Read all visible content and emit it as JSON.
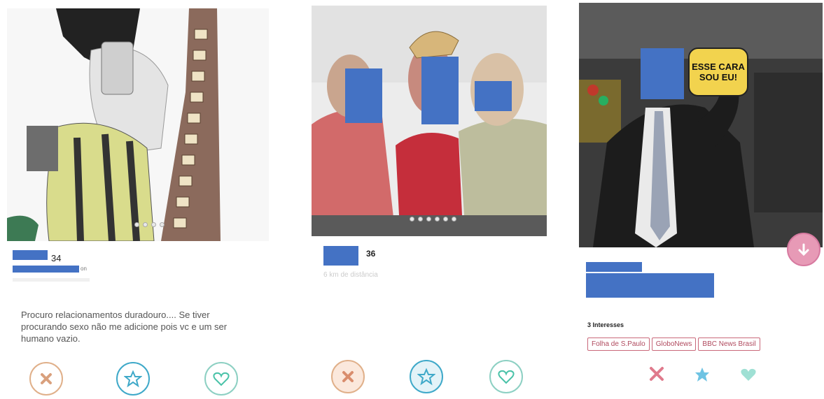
{
  "profiles": [
    {
      "age": "34",
      "bio": "Procuro relacionamentos duradouro.... Se tiver procurando sexo não me adicione pois vc e um ser humano vazio.",
      "truncated_suffix": "on"
    },
    {
      "age": "36",
      "distance": "6 km de distância"
    },
    {
      "interests_title": "3 Interesses",
      "interests": [
        "Folha de S.Paulo",
        "GloboNews",
        "BBC News Brasil"
      ],
      "sign_text": "ESSE CARA SOU EU!"
    }
  ],
  "colors": {
    "redaction": "#4472c4",
    "dislike": "#e07a73",
    "superlike": "#3fa9c9",
    "like": "#49c2a8"
  },
  "icons": [
    "close-icon",
    "star-icon",
    "heart-icon",
    "arrow-down-icon"
  ]
}
